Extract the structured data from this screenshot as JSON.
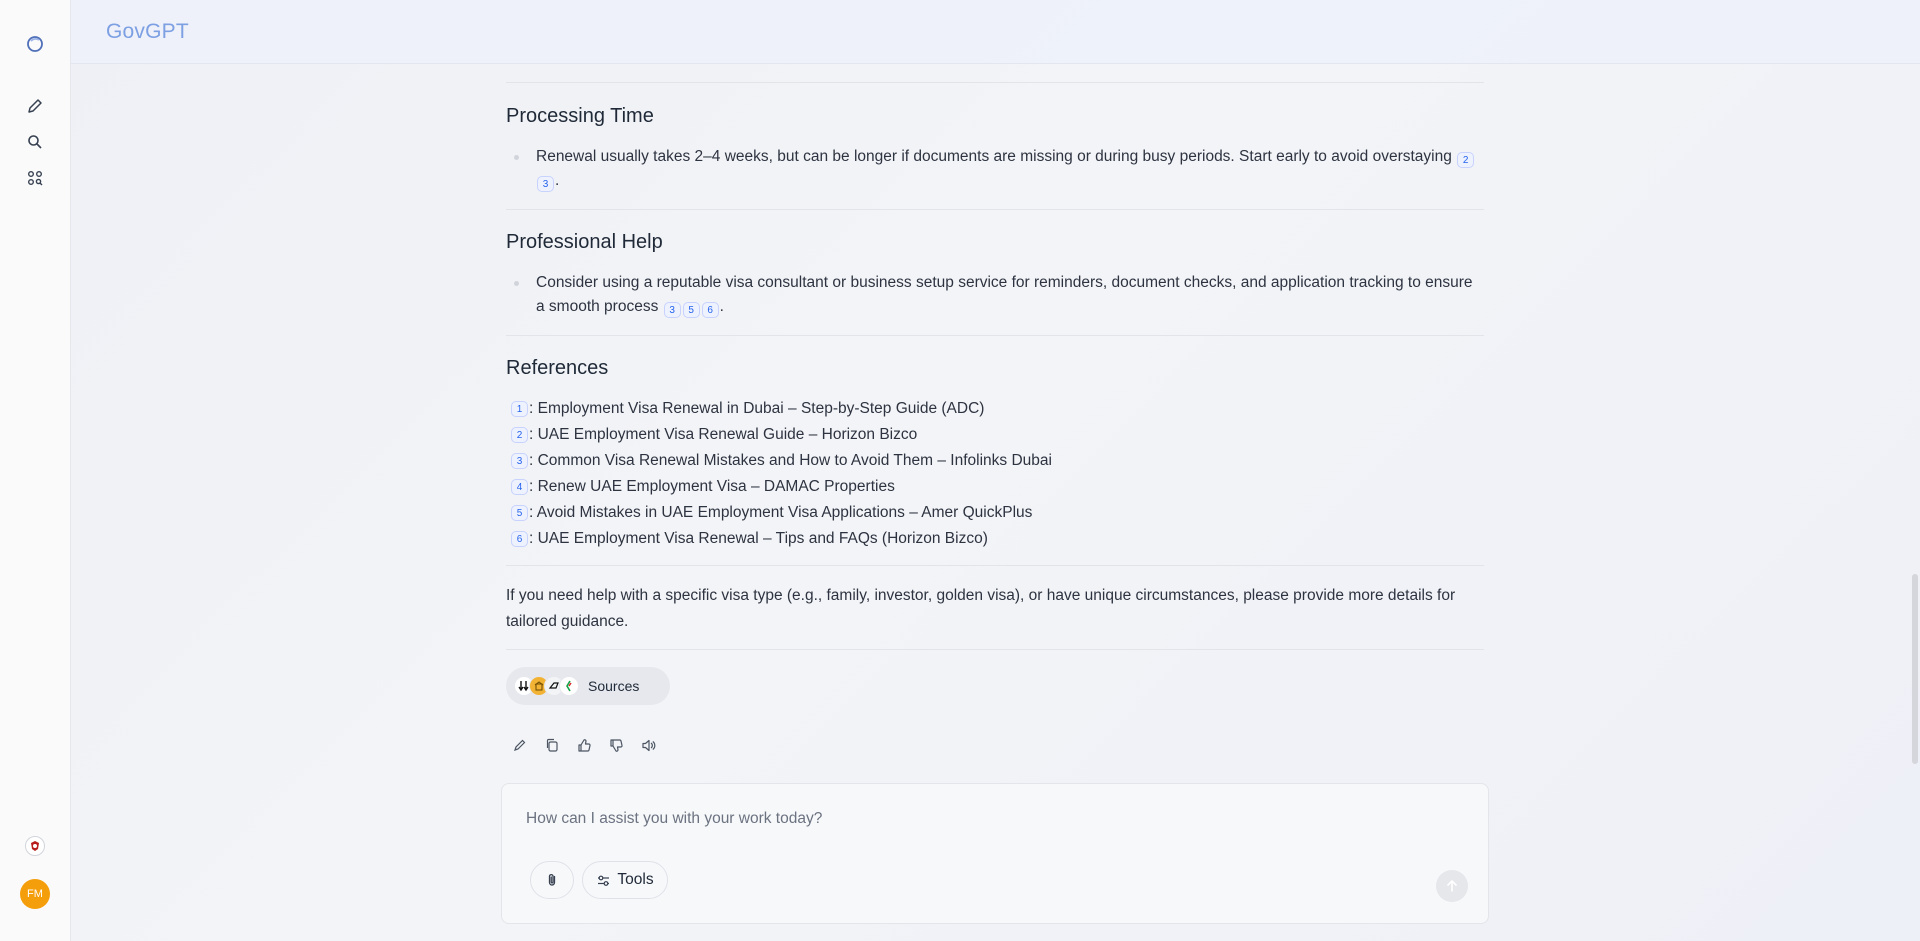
{
  "app": {
    "brand": "GovGPT"
  },
  "sidebar": {
    "icons": [
      "logo-icon",
      "new-chat-icon",
      "search-icon",
      "apps-icon"
    ],
    "avatar_initials": "FM"
  },
  "sections": [
    {
      "title": "Processing Time",
      "text": "Renewal usually takes 2–4 weeks, but can be longer if documents are missing or during busy periods. Start early to avoid overstaying",
      "citations": [
        "2",
        "3"
      ]
    },
    {
      "title": "Professional Help",
      "text": "Consider using a reputable visa consultant or business setup service for reminders, document checks, and application tracking to ensure a smooth process",
      "citations": [
        "3",
        "5",
        "6"
      ]
    }
  ],
  "references": {
    "title": "References",
    "items": [
      {
        "num": "1",
        "text": ": Employment Visa Renewal in Dubai – Step-by-Step Guide (ADC)"
      },
      {
        "num": "2",
        "text": ": UAE Employment Visa Renewal Guide – Horizon Bizco"
      },
      {
        "num": "3",
        "text": ": Common Visa Renewal Mistakes and How to Avoid Them – Infolinks Dubai"
      },
      {
        "num": "4",
        "text": ": Renew UAE Employment Visa – DAMAC Properties"
      },
      {
        "num": "5",
        "text": ": Avoid Mistakes in UAE Employment Visa Applications – Amer QuickPlus"
      },
      {
        "num": "6",
        "text": ": UAE Employment Visa Renewal – Tips and FAQs (Horizon Bizco)"
      }
    ]
  },
  "closing": "If you need help with a specific visa type (e.g., family, investor, golden visa), or have unique circumstances, please provide more details for tailored guidance.",
  "sources": {
    "label": "Sources"
  },
  "message_actions": [
    "edit-icon",
    "copy-icon",
    "thumbs-up-icon",
    "thumbs-down-icon",
    "read-aloud-icon"
  ],
  "composer": {
    "placeholder": "How can I assist you with your work today?",
    "tools_label": "Tools"
  },
  "colors": {
    "brand": "#7da0e3",
    "citation": "#2563eb",
    "avatar": "#f59e0b"
  }
}
